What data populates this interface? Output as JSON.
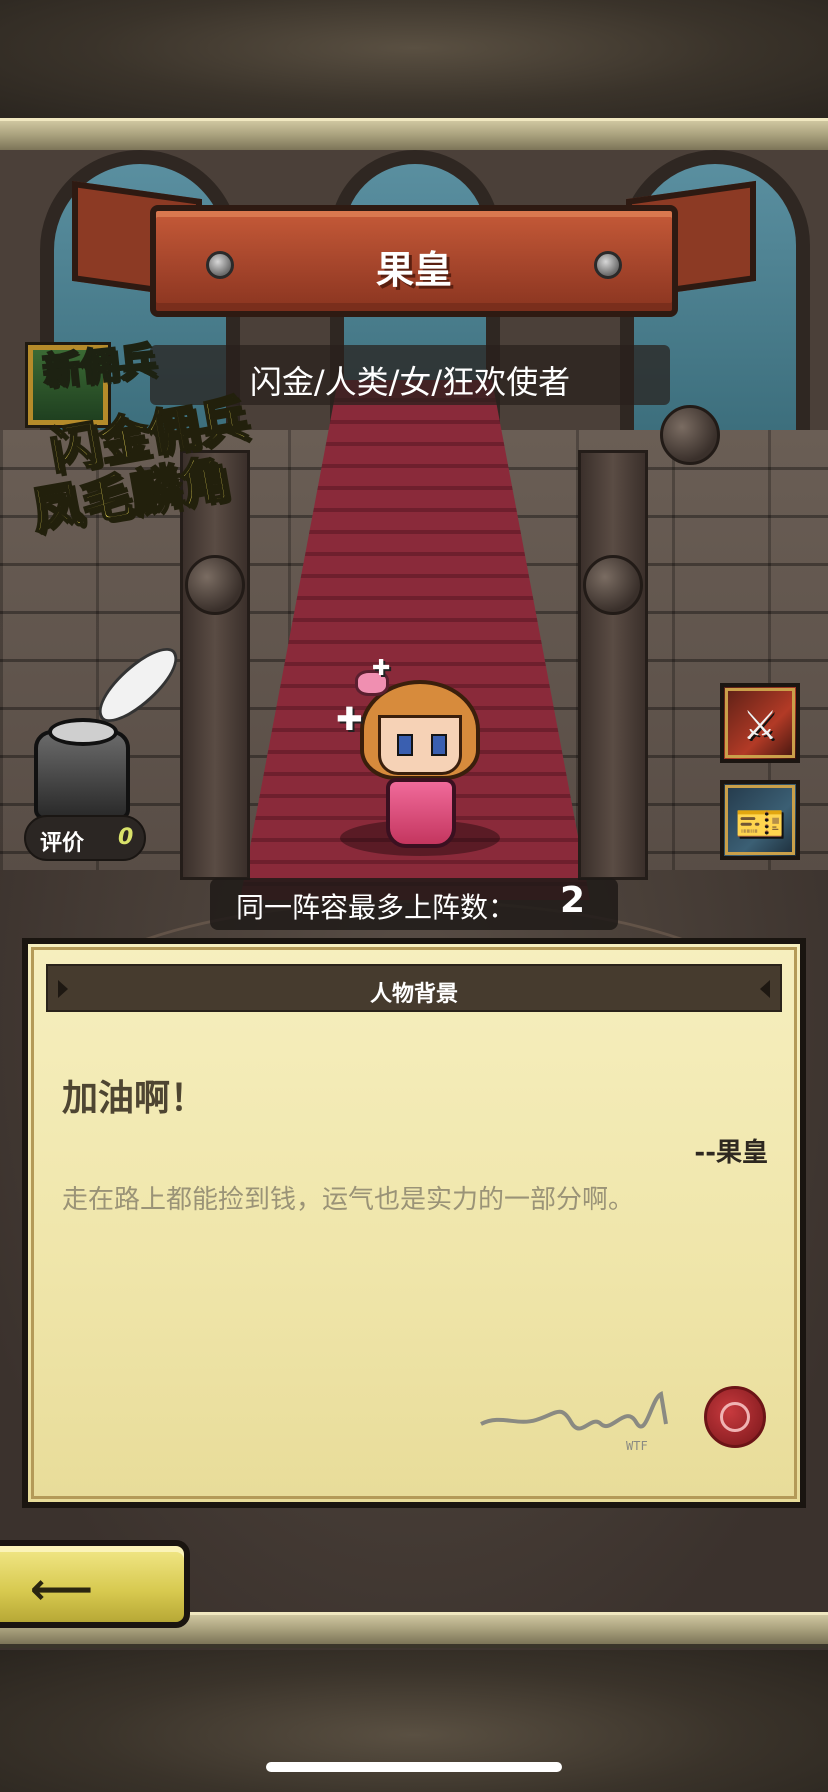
{
  "hero": {
    "name": "果皇",
    "subtitle": "闪金/人类/女/狂欢使者"
  },
  "badge": {
    "new_label": "新佣兵",
    "line1": "闪金佣兵",
    "line2": "凤毛麟角"
  },
  "rating": {
    "label": "评价",
    "value": "0"
  },
  "deploy": {
    "label": "同一阵容最多上阵数：",
    "value": "2"
  },
  "panel": {
    "header": "人物背景",
    "quote": "加油啊！",
    "author": "--果皇",
    "description": "走在路上都能捡到钱，运气也是实力的一部分啊。"
  },
  "icons": {
    "skill": "crossed-swords-icon",
    "item": "ticket-icon",
    "back": "back-arrow-icon"
  },
  "colors": {
    "ribbon": "#a2432a",
    "parchment": "#efe5a9",
    "back_button": "#d7c94f",
    "rating_value": "#d9e26a"
  }
}
